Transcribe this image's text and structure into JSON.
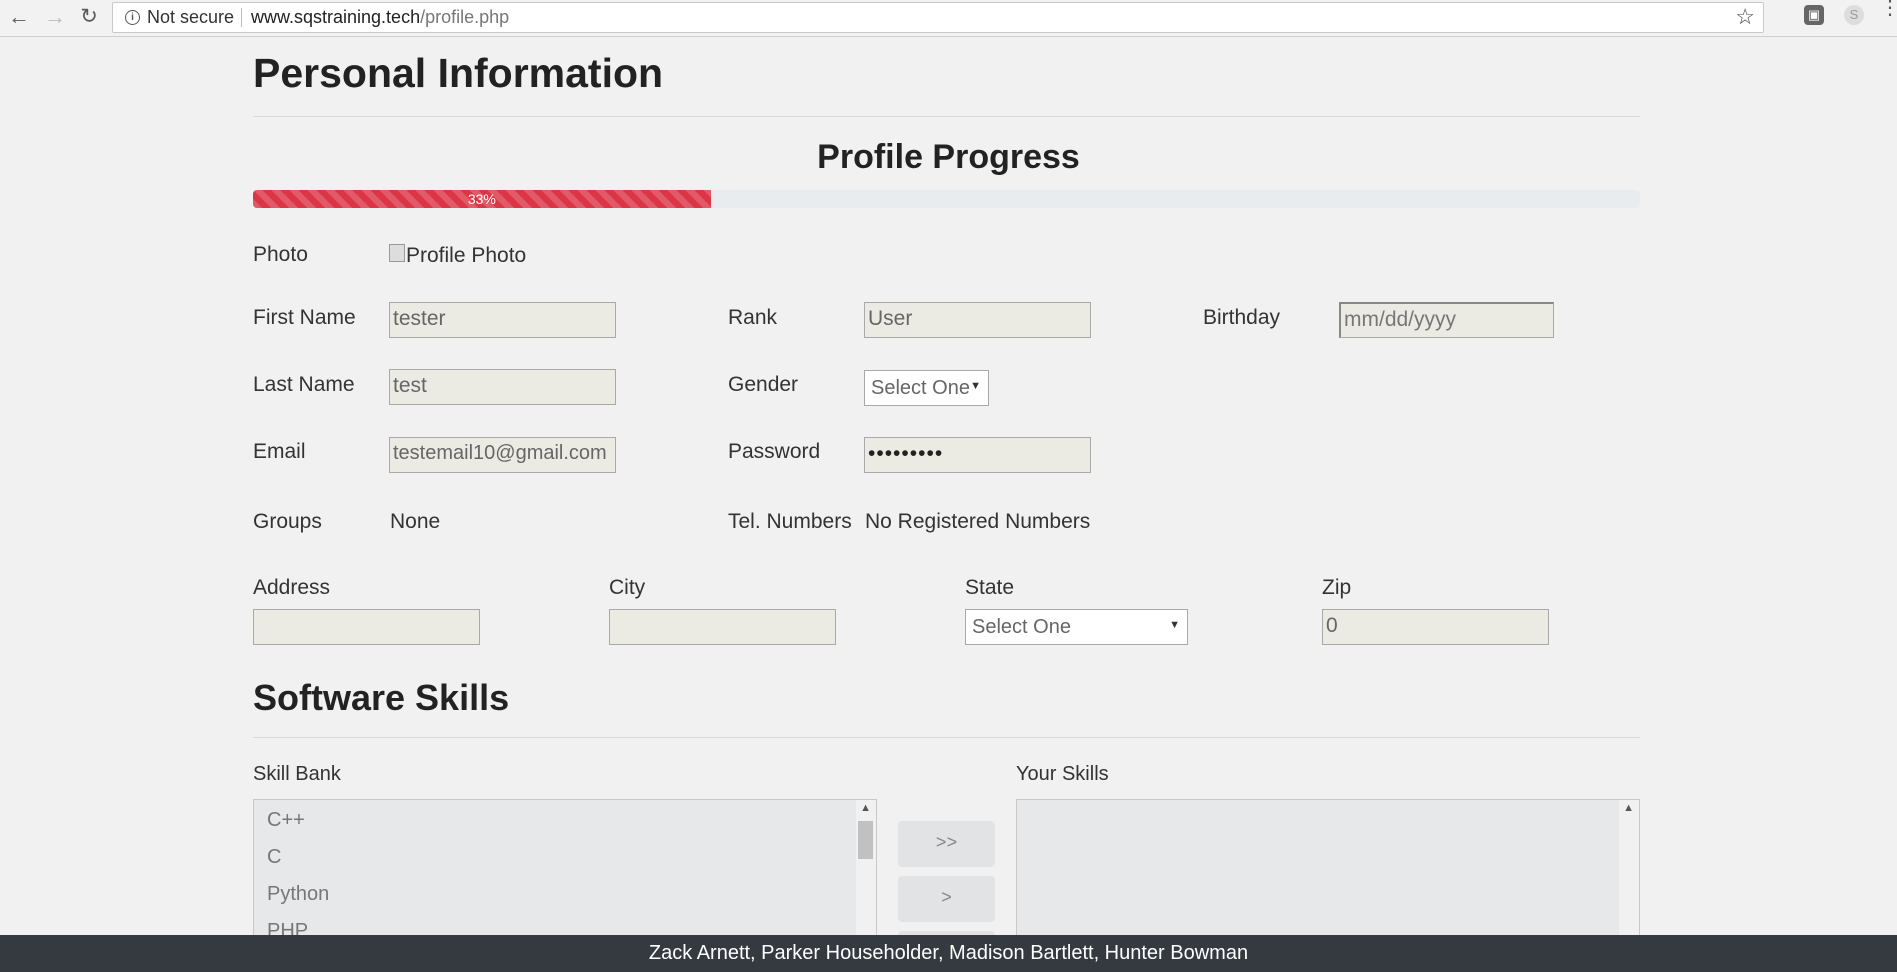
{
  "browser": {
    "security_label": "Not secure",
    "url_host": "www.sqstraining.tech",
    "url_path": "/profile.php"
  },
  "headings": {
    "personal_info": "Personal Information",
    "profile_progress": "Profile Progress",
    "software_skills": "Software Skills"
  },
  "progress": {
    "value_percent": 33,
    "label": "33%",
    "bar_color": "#dc3545"
  },
  "profile": {
    "photo_label": "Photo",
    "photo_alt": "Profile Photo",
    "first_name_label": "First Name",
    "first_name_value": "tester",
    "last_name_label": "Last Name",
    "last_name_value": "test",
    "email_label": "Email",
    "email_value": "testemail10@gmail.com",
    "groups_label": "Groups",
    "groups_value": "None",
    "rank_label": "Rank",
    "rank_value": "User",
    "gender_label": "Gender",
    "gender_value": "Select One",
    "password_label": "Password",
    "password_value": "•••••••••",
    "tel_label": "Tel. Numbers",
    "tel_value": "No Registered Numbers",
    "birthday_label": "Birthday",
    "birthday_placeholder": "mm/dd/yyyy"
  },
  "address": {
    "address_label": "Address",
    "address_value": "",
    "city_label": "City",
    "city_value": "",
    "state_label": "State",
    "state_value": "Select One",
    "zip_label": "Zip",
    "zip_value": "0"
  },
  "skills": {
    "bank_label": "Skill Bank",
    "yours_label": "Your Skills",
    "bank_items": [
      "C++",
      "C",
      "Python",
      "PHP"
    ],
    "add_all_label": ">>",
    "add_label": ">"
  },
  "footer": {
    "credits": "Zack Arnett, Parker Householder, Madison Bartlett, Hunter Bowman"
  }
}
